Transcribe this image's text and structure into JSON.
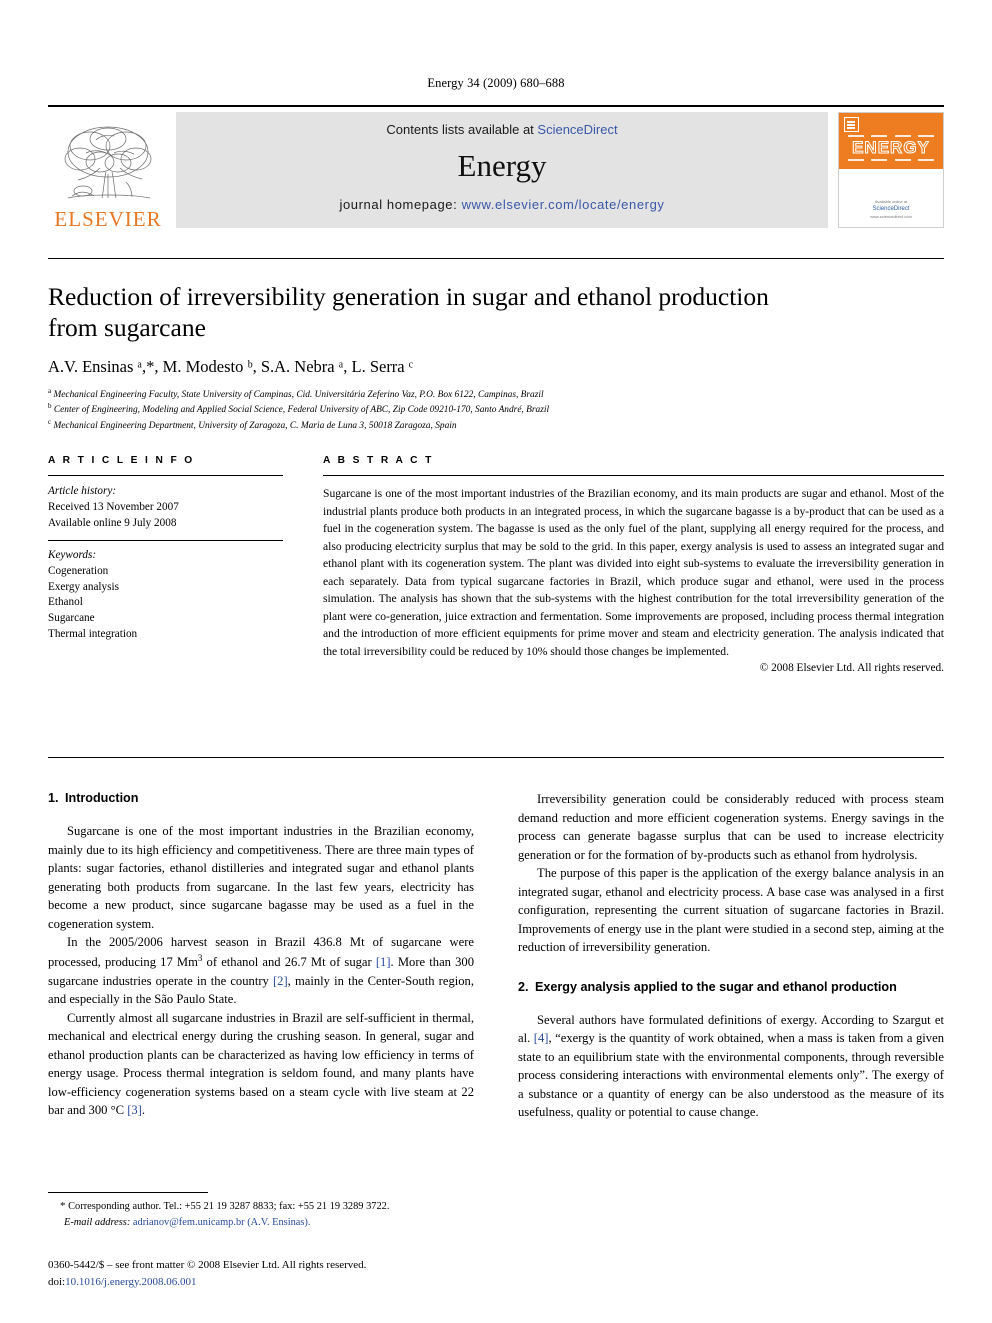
{
  "running_head": "Energy 34 (2009) 680–688",
  "masthead": {
    "publisher_name": "ELSEVIER",
    "contents_prefix": "Contents lists available at ",
    "contents_link": "ScienceDirect",
    "journal_name": "Energy",
    "homepage_prefix": "journal homepage: ",
    "homepage_url": "www.elsevier.com/locate/energy",
    "cover_title": "ENERGY",
    "cover_footer": "Available online at",
    "cover_footer_link": "ScienceDirect",
    "cover_footer_url": "www.sciencedirect.com"
  },
  "article": {
    "title": "Reduction of irreversibility generation in sugar and ethanol production from sugarcane",
    "authors": "A.V. Ensinas ᵃ,*, M. Modesto ᵇ, S.A. Nebra ᵃ, L. Serra ᶜ",
    "affiliations": [
      "Mechanical Engineering Faculty, State University of Campinas, Cid. Universitária Zeferino Vaz, P.O. Box 6122, Campinas, Brazil",
      "Center of Engineering, Modeling and Applied Social Science, Federal University of ABC, Zip Code 09210-170, Santo André, Brazil",
      "Mechanical Engineering Department, University of Zaragoza, C. Maria de Luna 3, 50018 Zaragoza, Spain"
    ],
    "affiliation_markers": [
      "a",
      "b",
      "c"
    ]
  },
  "article_info": {
    "heading": "A R T I C L E  I N F O",
    "history_label": "Article history:",
    "history": [
      "Received 13 November 2007",
      "Available online 9 July 2008"
    ],
    "keywords_label": "Keywords:",
    "keywords": [
      "Cogeneration",
      "Exergy analysis",
      "Ethanol",
      "Sugarcane",
      "Thermal integration"
    ]
  },
  "abstract": {
    "heading": "A B S T R A C T",
    "text": "Sugarcane is one of the most important industries of the Brazilian economy, and its main products are sugar and ethanol. Most of the industrial plants produce both products in an integrated process, in which the sugarcane bagasse is a by-product that can be used as a fuel in the cogeneration system. The bagasse is used as the only fuel of the plant, supplying all energy required for the process, and also producing electricity surplus that may be sold to the grid. In this paper, exergy analysis is used to assess an integrated sugar and ethanol plant with its cogeneration system. The plant was divided into eight sub-systems to evaluate the irreversibility generation in each separately. Data from typical sugarcane factories in Brazil, which produce sugar and ethanol, were used in the process simulation. The analysis has shown that the sub-systems with the highest contribution for the total irreversibility generation of the plant were co-generation, juice extraction and fermentation. Some improvements are proposed, including process thermal integration and the introduction of more efficient equipments for prime mover and steam and electricity generation. The analysis indicated that the total irreversibility could be reduced by 10% should those changes be implemented.",
    "copyright": "© 2008 Elsevier Ltd. All rights reserved."
  },
  "sections": {
    "intro": {
      "number": "1.",
      "title": "Introduction",
      "paragraphs": [
        {
          "parts": [
            {
              "t": "Sugarcane is one of the most important industries in the Brazilian economy, mainly due to its high efficiency and competitiveness. There are three main types of plants: sugar factories, ethanol distilleries and integrated sugar and ethanol plants generating both products from sugarcane. In the last few years, electricity has become a new product, since sugarcane bagasse may be used as a fuel in the cogeneration system."
            }
          ]
        },
        {
          "parts": [
            {
              "t": "In the 2005/2006 harvest season in Brazil 436.8 Mt of sugarcane were processed, producing 17 Mm"
            },
            {
              "t": "3",
              "sup": true
            },
            {
              "t": " of ethanol and 26.7 Mt of sugar "
            },
            {
              "t": "[1]",
              "ref": true
            },
            {
              "t": ". More than 300 sugarcane industries operate in the country "
            },
            {
              "t": "[2]",
              "ref": true
            },
            {
              "t": ", mainly in the Center-South region, and especially in the São Paulo State."
            }
          ]
        },
        {
          "parts": [
            {
              "t": "Currently almost all sugarcane industries in Brazil are self-sufficient in thermal, mechanical and electrical energy during the crushing season. In general, sugar and ethanol production plants can be characterized as having low efficiency in terms of energy usage. Process thermal integration is seldom found, and many plants have low-efficiency cogeneration systems based on a steam cycle with live steam at 22 bar and 300 °C "
            },
            {
              "t": "[3]",
              "ref": true
            },
            {
              "t": "."
            }
          ]
        }
      ]
    },
    "intro_continued": {
      "paragraphs": [
        {
          "parts": [
            {
              "t": "Irreversibility generation could be considerably reduced with process steam demand reduction and more efficient cogeneration systems. Energy savings in the process can generate bagasse surplus that can be used to increase electricity generation or for the formation of by-products such as ethanol from hydrolysis."
            }
          ]
        },
        {
          "parts": [
            {
              "t": "The purpose of this paper is the application of the exergy balance analysis in an integrated sugar, ethanol and electricity process. A base case was analysed in a first configuration, representing the current situation of sugarcane factories in Brazil. Improvements of energy use in the plant were studied in a second step, aiming at the reduction of irreversibility generation."
            }
          ]
        }
      ]
    },
    "exergy": {
      "number": "2.",
      "title": "Exergy analysis applied to the sugar and ethanol production",
      "paragraphs": [
        {
          "parts": [
            {
              "t": "Several authors have formulated definitions of exergy. According to Szargut et al. "
            },
            {
              "t": "[4]",
              "ref": true
            },
            {
              "t": ", “exergy is the quantity of work obtained, when a mass is taken from a given state to an equilibrium state with the environmental components, through reversible process considering interactions with environmental elements only”. The exergy of a substance or a quantity of energy can be also understood as the measure of its usefulness, quality or potential to cause change."
            }
          ]
        }
      ]
    }
  },
  "footnote": {
    "marker": "*",
    "corresponding": "Corresponding author. Tel.: +55 21 19 3287 8833; fax: +55 21 19 3289 3722.",
    "email_label": "E-mail address:",
    "email": "adrianov@fem.unicamp.br (A.V. Ensinas)."
  },
  "imprint": {
    "issn_line": "0360-5442/$ – see front matter © 2008 Elsevier Ltd. All rights reserved.",
    "doi_label": "doi:",
    "doi": "10.1016/j.energy.2008.06.001"
  },
  "colors": {
    "link": "#2a4b9b",
    "elsevier_orange": "#E87722",
    "masthead_grey": "#e3e3e3"
  }
}
